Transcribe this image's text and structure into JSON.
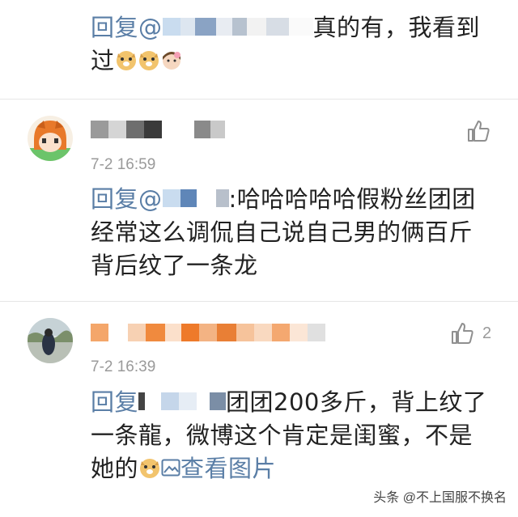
{
  "comments": [
    {
      "reply_prefix": "回复@",
      "reply_text_line1": "真的有，我看到",
      "reply_text_line2": "过"
    },
    {
      "time": "7-2 16:59",
      "reply_prefix": "回复@",
      "reply_text": ":哈哈哈哈哈假粉丝团团经常这么调侃自己说自己男的俩百斤背后纹了一条龙"
    },
    {
      "time": "7-2 16:39",
      "like_count": "2",
      "reply_prefix": "回复",
      "reply_text": "团团200多斤，背上纹了一条龍，微博这个肯定是闺蜜，不是她的",
      "image_link": "查看图片"
    }
  ],
  "watermark": "头条 @不上国服不换名",
  "icons": {
    "like": "thumbs-up-icon",
    "image": "image-icon",
    "emoji": "doge-emoji-icon"
  }
}
